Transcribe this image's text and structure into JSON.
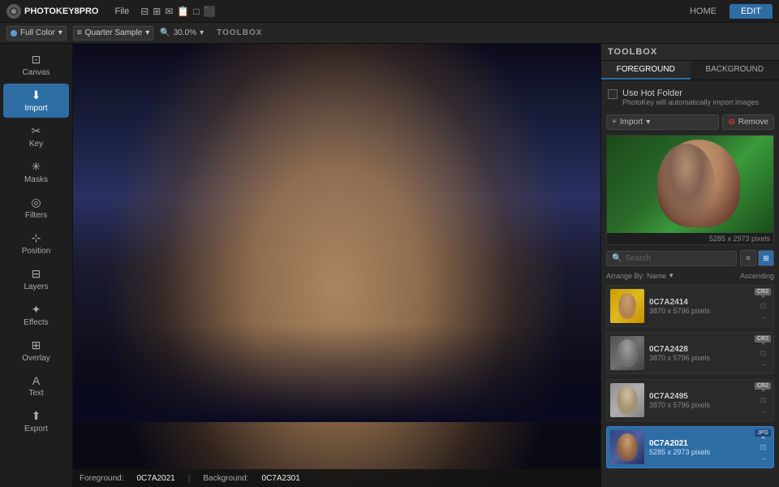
{
  "app": {
    "title": "PHOTOKEY8PRO",
    "logo_char": "P"
  },
  "topbar": {
    "menu_items": [
      "File"
    ],
    "toolbar_icons": [
      "⊟",
      "⊞",
      "✉",
      "📋",
      "□",
      "⬛"
    ],
    "nav": {
      "home_label": "HOME",
      "edit_label": "EDIT",
      "active": "EDIT"
    }
  },
  "toolbar2": {
    "color_mode_label": "Full Color",
    "sample_label": "Quarter Sample",
    "zoom_icon": "🔍",
    "zoom_value": "30.0%",
    "toolbox_label": "TOOLBOX"
  },
  "sidebar": {
    "items": [
      {
        "id": "canvas",
        "label": "Canvas",
        "icon": "⊡"
      },
      {
        "id": "import",
        "label": "Import",
        "icon": "⬇",
        "active": true
      },
      {
        "id": "key",
        "label": "Key",
        "icon": "✂"
      },
      {
        "id": "masks",
        "label": "Masks",
        "icon": "✳"
      },
      {
        "id": "filters",
        "label": "Filters",
        "icon": "◎"
      },
      {
        "id": "position",
        "label": "Position",
        "icon": "⊹"
      },
      {
        "id": "layers",
        "label": "Layers",
        "icon": "⊟"
      },
      {
        "id": "effects",
        "label": "Effects",
        "icon": "✦"
      },
      {
        "id": "overlay",
        "label": "Overlay",
        "icon": "⊞"
      },
      {
        "id": "text",
        "label": "Text",
        "icon": "A"
      },
      {
        "id": "export",
        "label": "Export",
        "icon": "⬆"
      }
    ]
  },
  "toolbox": {
    "header": "TOOLBOX",
    "tabs": [
      {
        "id": "foreground",
        "label": "FOREGROUND",
        "active": true
      },
      {
        "id": "background",
        "label": "BACKGROUND"
      }
    ],
    "hot_folder": {
      "label": "Use Hot Folder",
      "sublabel": "PhotoKey will automatically import images"
    },
    "import_btn": "Import",
    "remove_btn": "Remove",
    "preview_dims": "5285 x 2973 pixels",
    "search_placeholder": "Search",
    "arrange_label": "Arrange By: Name",
    "order_label": "Ascending",
    "files": [
      {
        "id": "0C7A2414",
        "name": "0C7A2414",
        "dims": "3870 x 5796 pixels",
        "badge": "CR2",
        "thumb_class": "thumb-yellow",
        "selected": false
      },
      {
        "id": "0C7A2428",
        "name": "0C7A2428",
        "dims": "3870 x 5796 pixels",
        "badge": "CR2",
        "thumb_class": "thumb-gray",
        "selected": false
      },
      {
        "id": "0C7A2495",
        "name": "0C7A2495",
        "dims": "3870 x 5796 pixels",
        "badge": "CR2",
        "thumb_class": "thumb-light",
        "selected": false
      },
      {
        "id": "0C7A2021",
        "name": "0C7A2021",
        "dims": "5285 x 2973 pixels",
        "badge": "JPG",
        "thumb_class": "thumb-blue",
        "selected": true
      }
    ]
  },
  "status": {
    "foreground_label": "Foreground:",
    "foreground_value": "0C7A2021",
    "background_label": "Background:",
    "background_value": "0C7A2301"
  }
}
